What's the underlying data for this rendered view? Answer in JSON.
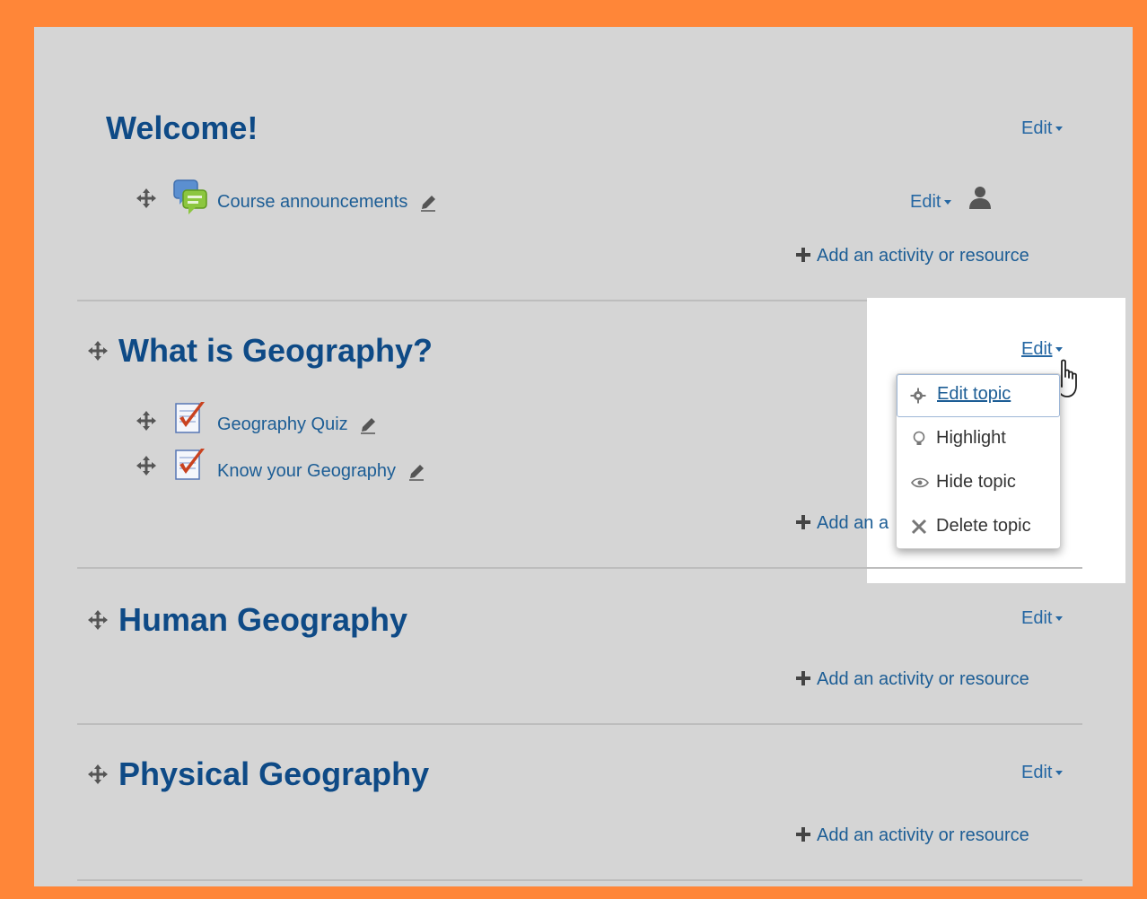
{
  "sections": {
    "welcome": {
      "title": "Welcome!",
      "edit_label": "Edit",
      "activities": [
        {
          "name": "Course announcements",
          "edit_label": "Edit"
        }
      ],
      "add_label": "Add an activity or resource"
    },
    "what_is_geography": {
      "title": "What is Geography?",
      "edit_label": "Edit",
      "activities": [
        {
          "name": "Geography Quiz"
        },
        {
          "name": "Know your Geography"
        }
      ],
      "add_label_partial": "Add an a"
    },
    "human_geography": {
      "title": "Human Geography",
      "edit_label": "Edit",
      "add_label": "Add an activity or resource"
    },
    "physical_geography": {
      "title": "Physical Geography",
      "edit_label": "Edit",
      "add_label": "Add an activity or resource"
    }
  },
  "edit_menu": {
    "items": [
      {
        "label": "Edit topic",
        "icon": "gear-icon"
      },
      {
        "label": "Highlight",
        "icon": "lightbulb-icon"
      },
      {
        "label": "Hide topic",
        "icon": "eye-icon"
      },
      {
        "label": "Delete topic",
        "icon": "close-icon"
      }
    ]
  },
  "colors": {
    "frame_border": "#ff8638",
    "background": "#d5d5d5",
    "title": "#0e4a86",
    "link": "#1c5d95"
  }
}
